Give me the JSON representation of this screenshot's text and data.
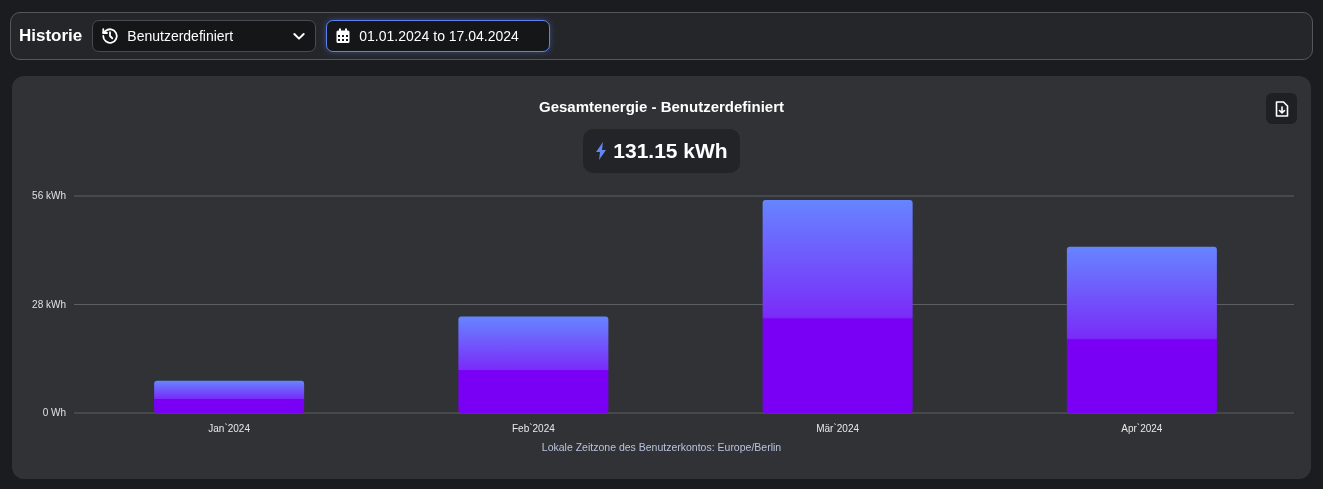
{
  "header": {
    "title": "Historie",
    "period_select": {
      "value": "Benutzerdefiniert"
    },
    "date_range": {
      "value": "01.01.2024 to 17.04.2024",
      "focused": true
    }
  },
  "card": {
    "title": "Gesamtenergie - Benutzerdefiniert",
    "total": "131.15 kWh",
    "chart_data": {
      "type": "bar",
      "categories": [
        "Jan`2024",
        "Feb`2024",
        "Mär`2024",
        "Apr`2024"
      ],
      "series": [
        {
          "color": "#7a00f5",
          "values": [
            8.3,
            24.9,
            55.0,
            42.9
          ]
        }
      ],
      "ylim": [
        0,
        56
      ],
      "yticks": [
        {
          "value": 0,
          "label": "0 Wh"
        },
        {
          "value": 28,
          "label": "28 kWh"
        },
        {
          "value": 56,
          "label": "56 kWh"
        }
      ]
    },
    "footnote": "Lokale Zeitzone des Benutzerkontos: Europe/Berlin"
  }
}
